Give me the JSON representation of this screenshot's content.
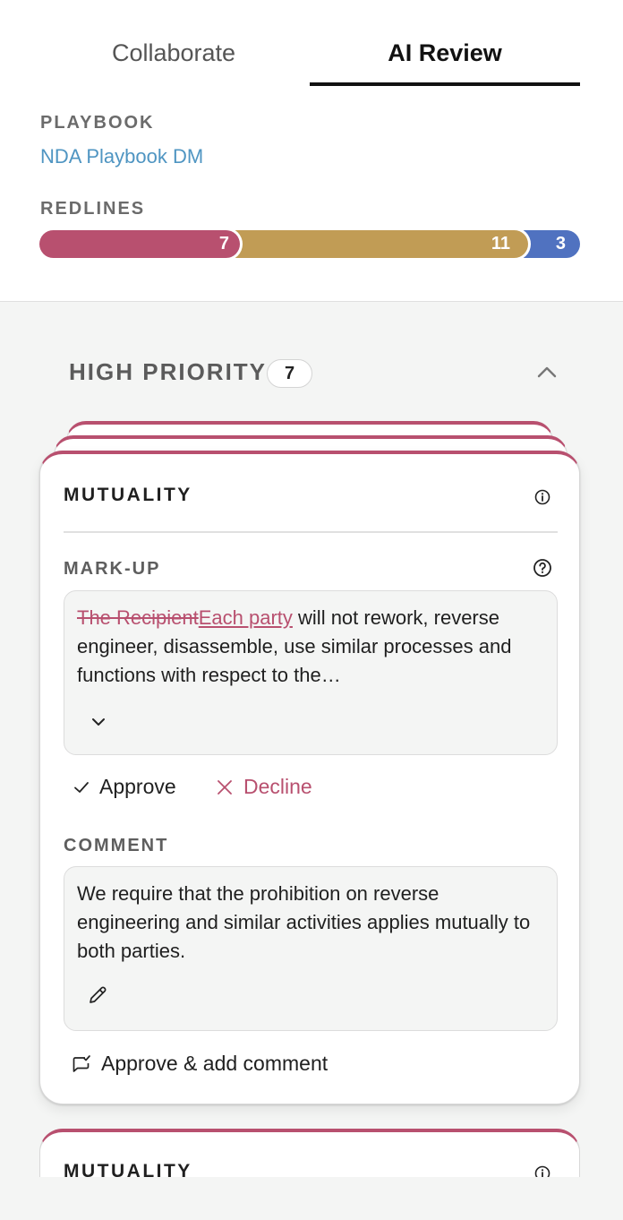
{
  "tabs": [
    {
      "label": "Collaborate",
      "active": false
    },
    {
      "label": "AI Review",
      "active": true
    }
  ],
  "playbook": {
    "label": "PLAYBOOK",
    "name": "NDA Playbook DM"
  },
  "redlines": {
    "label": "REDLINES",
    "segments": [
      {
        "count": "7",
        "color": "#b8506f",
        "priority": "high"
      },
      {
        "count": "11",
        "color": "#c19c55",
        "priority": "medium"
      },
      {
        "count": "3",
        "color": "#5072c0",
        "priority": "low"
      }
    ]
  },
  "priority_group": {
    "title": "HIGH PRIORITY",
    "count": "7",
    "collapse_icon": "chevron-up-icon"
  },
  "card": {
    "title": "MUTUALITY",
    "info_icon": "info-icon",
    "markup_label": "MARK-UP",
    "help_icon": "help-circle-icon",
    "markup": {
      "deleted": "The Recipient",
      "inserted": "Each party",
      "rest": " will not rework, reverse engineer, disassemble, use similar processes and functions with respect to the…"
    },
    "approve_label": "Approve",
    "decline_label": "Decline",
    "comment_label": "COMMENT",
    "comment_text": "We require that the prohibition on reverse engineering and similar activities applies mutually to both parties.",
    "approve_comment_label": "Approve & add comment"
  },
  "next_card": {
    "title": "MUTUALITY"
  },
  "colors": {
    "accent_red": "#b8506f",
    "link_blue": "#4f95c2"
  }
}
